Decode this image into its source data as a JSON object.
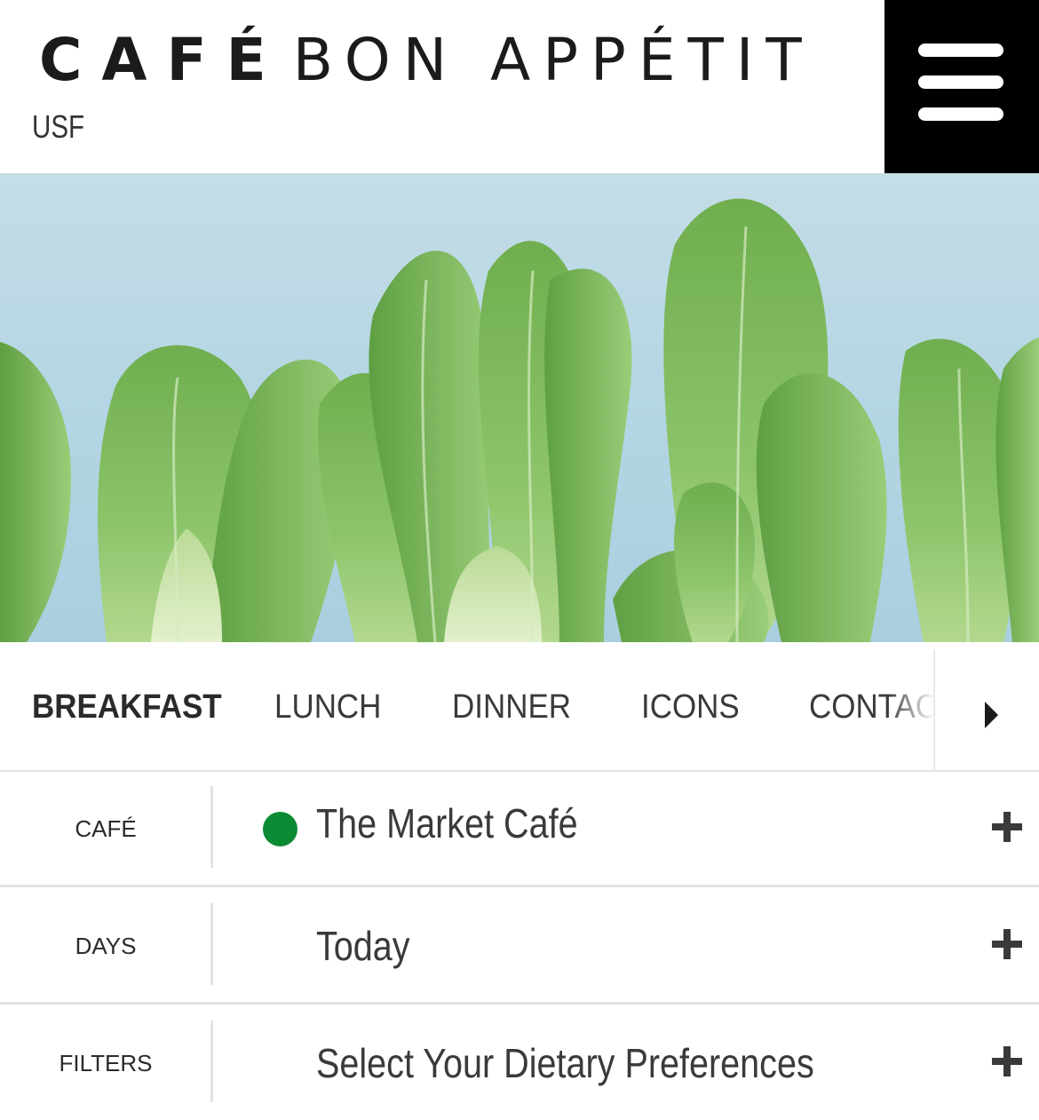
{
  "header": {
    "logo_cafe": "CAFÉ",
    "logo_bon": "BON APPÉTIT",
    "site": "USF"
  },
  "hero": {
    "image": "bok-choy-hero-image",
    "background_color": "#b6d6e4",
    "leaf_color": "#7cb859"
  },
  "meal_tabs": {
    "items": [
      {
        "label": "BREAKFAST",
        "active": true
      },
      {
        "label": "LUNCH",
        "active": false
      },
      {
        "label": "DINNER",
        "active": false
      },
      {
        "label": "ICONS",
        "active": false
      },
      {
        "label": "CONTAC",
        "active": false
      }
    ],
    "next_icon": "caret-right-icon"
  },
  "filters": {
    "cafe": {
      "label": "CAFÉ",
      "value": "The Market Café",
      "status_color": "#0a8a32"
    },
    "days": {
      "label": "DAYS",
      "value": "Today"
    },
    "dietary": {
      "label": "FILTERS",
      "value": "Select Your Dietary Preferences"
    },
    "expand_icon": "plus-icon"
  },
  "colors": {
    "header_menu_bg": "#000000",
    "text": "#3a3a3a",
    "divider": "#e3e3e3"
  }
}
